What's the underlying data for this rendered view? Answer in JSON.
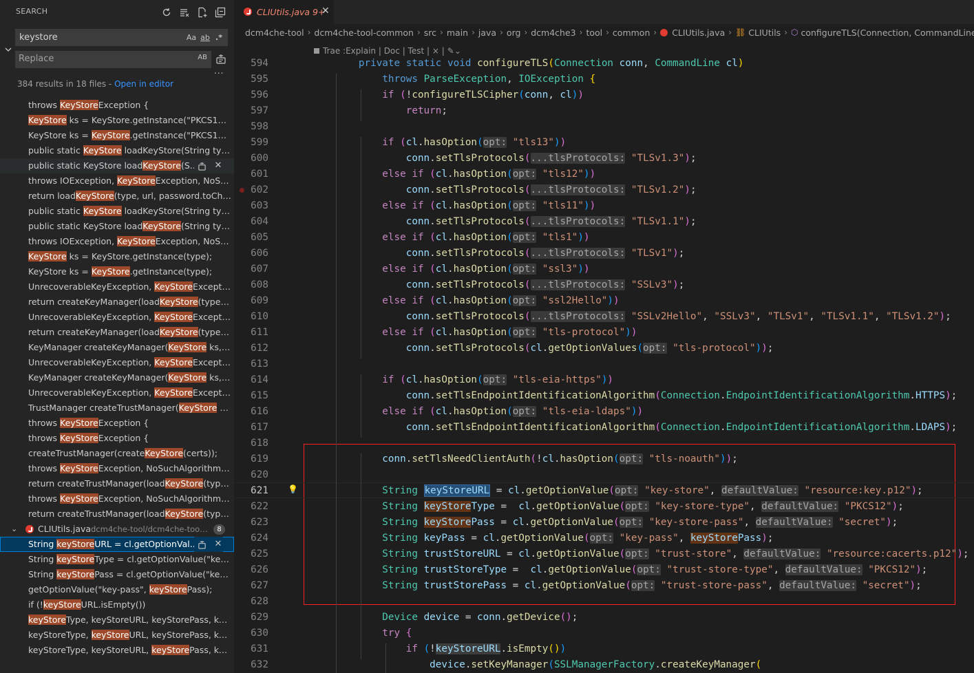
{
  "sidebar": {
    "title": "SEARCH",
    "search_value": "keystore",
    "replace_placeholder": "Replace",
    "opt_case": "Aa",
    "opt_word": "ab",
    "opt_regex": ".*",
    "opt_preserve_case": "AB",
    "summary": "384 results in 18 files - ",
    "open_in_editor": "Open in editor",
    "more": "...",
    "file": {
      "name": "CLIUtils.java",
      "path": "dcm4che-tool/dcm4che-tool-c...",
      "count": "8"
    }
  },
  "results": [
    [
      "throws ",
      "KeyStore",
      "Exception {"
    ],
    [
      "",
      "KeyStore",
      " ks = KeyStore.getInstance(\"PKCS12\");"
    ],
    [
      "KeyStore ks = ",
      "KeyStore",
      ".getInstance(\"PKCS12\");"
    ],
    [
      "public static ",
      "KeyStore",
      " loadKeyStore(String type, ..."
    ],
    [
      "public static KeyStore load",
      "KeyStore",
      "(S..."
    ],
    [
      "throws IOException, ",
      "KeyStore",
      "Exception, NoSuch..."
    ],
    [
      "return load",
      "KeyStore",
      "(type, url, password.toChar..."
    ],
    [
      "public static ",
      "KeyStore",
      " loadKeyStore(String type, ..."
    ],
    [
      "public static KeyStore load",
      "KeyStore",
      "(String type, ..."
    ],
    [
      "throws IOException, ",
      "KeyStore",
      "Exception, NoSuch..."
    ],
    [
      "",
      "KeyStore",
      " ks = KeyStore.getInstance(type);"
    ],
    [
      "KeyStore ks = ",
      "KeyStore",
      ".getInstance(type);"
    ],
    [
      "UnrecoverableKeyException, ",
      "KeyStore",
      "Exception,"
    ],
    [
      "return createKeyManager(load",
      "KeyStore",
      "(type, ur..."
    ],
    [
      "UnrecoverableKeyException, ",
      "KeyStore",
      "Exception,"
    ],
    [
      "return createKeyManager(load",
      "KeyStore",
      "(type, ur..."
    ],
    [
      "KeyManager createKeyManager(",
      "KeyStore",
      " ks, Str..."
    ],
    [
      "UnrecoverableKeyException, ",
      "KeyStore",
      "Exception {"
    ],
    [
      "KeyManager createKeyManager(",
      "KeyStore",
      " ks, ch..."
    ],
    [
      "UnrecoverableKeyException, ",
      "KeyStore",
      "Exception {"
    ],
    [
      "TrustManager createTrustManager(",
      "KeyStore",
      " ks)"
    ],
    [
      "throws ",
      "KeyStore",
      "Exception {"
    ],
    [
      "throws ",
      "KeyStore",
      "Exception {"
    ],
    [
      "createTrustManager(create",
      "KeyStore",
      "(certs));"
    ],
    [
      "throws ",
      "KeyStore",
      "Exception, NoSuchAlgorithmEx..."
    ],
    [
      "return createTrustManager(load",
      "KeyStore",
      "(type, ..."
    ],
    [
      "throws ",
      "KeyStore",
      "Exception, NoSuchAlgorithmEx..."
    ],
    [
      "return createTrustManager(load",
      "KeyStore",
      "(type, ..."
    ]
  ],
  "file_results": [
    [
      "String ",
      "keyStore",
      "URL = cl.getOptionVal..."
    ],
    [
      "String ",
      "keyStore",
      "Type = cl.getOptionValue(\"key-s..."
    ],
    [
      "String ",
      "keyStore",
      "Pass = cl.getOptionValue(\"key-st..."
    ],
    [
      "getOptionValue(\"key-pass\", ",
      "keyStore",
      "Pass);"
    ],
    [
      "if (!",
      "keyStore",
      "URL.isEmpty())"
    ],
    [
      "",
      "keyStore",
      "Type, keyStoreURL, keyStorePass, keyP..."
    ],
    [
      "keyStoreType, ",
      "keyStore",
      "URL, keyStorePass, keyP..."
    ],
    [
      "keyStoreType, keyStoreURL, ",
      "keyStore",
      "Pass, keyP..."
    ]
  ],
  "editor": {
    "tab_name": "CLIUtils.java 9+",
    "breadcrumb": [
      "dcm4che-tool",
      "dcm4che-tool-common",
      "src",
      "main",
      "java",
      "org",
      "dcm4che3",
      "tool",
      "common",
      "CLIUtils.java",
      "CLIUtils",
      "configureTLS(Connection, CommandLine)"
    ],
    "codelens": "Trae :Explain | Doc | Test | × |",
    "line_numbers": [
      "594",
      "595",
      "596",
      "597",
      "598",
      "599",
      "600",
      "601",
      "602",
      "603",
      "604",
      "605",
      "606",
      "607",
      "608",
      "609",
      "610",
      "611",
      "612",
      "613",
      "614",
      "615",
      "616",
      "617",
      "618",
      "619",
      "620",
      "621",
      "622",
      "623",
      "624",
      "625",
      "626",
      "627",
      "628",
      "629",
      "630",
      "631",
      "632"
    ]
  }
}
